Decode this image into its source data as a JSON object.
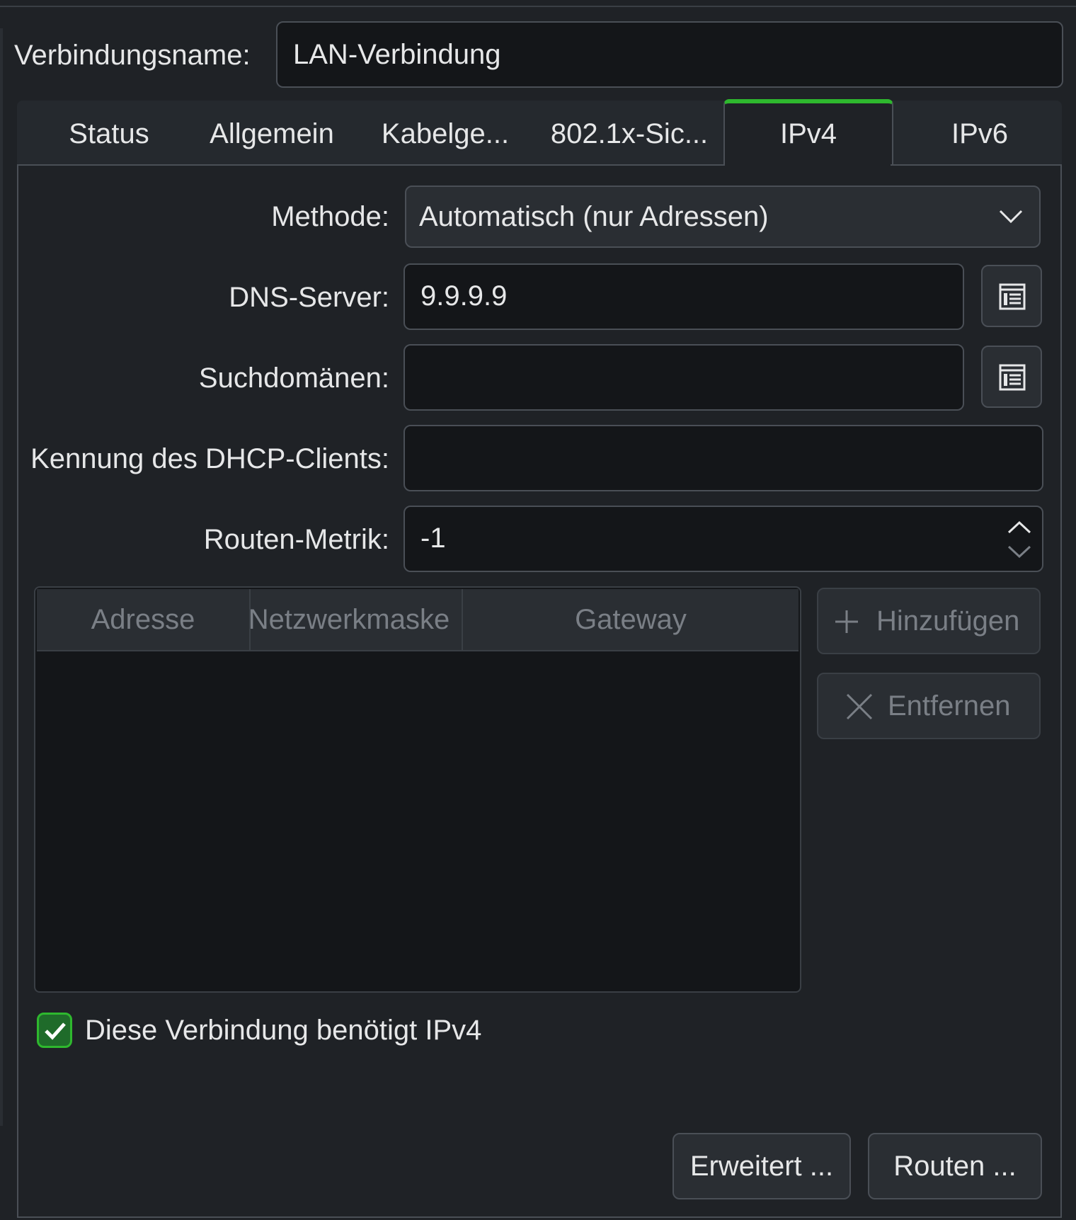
{
  "connection": {
    "name_label": "Verbindungsname:",
    "name_value": "LAN-Verbindung"
  },
  "tabs": [
    {
      "label": "Status"
    },
    {
      "label": "Allgemein"
    },
    {
      "label": "Kabelge..."
    },
    {
      "label": "802.1x-Sic..."
    },
    {
      "label": "IPv4",
      "active": true
    },
    {
      "label": "IPv6"
    }
  ],
  "form": {
    "method_label": "Methode:",
    "method_value": "Automatisch (nur Adressen)",
    "dns_label": "DNS-Server:",
    "dns_value": "9.9.9.9",
    "search_label": "Suchdomänen:",
    "search_value": "",
    "dhcp_label": "Kennung des DHCP-Clients:",
    "dhcp_value": "",
    "metric_label": "Routen-Metrik:",
    "metric_value": "-1"
  },
  "address_table": {
    "columns": [
      "Adresse",
      "Netzwerkmaske",
      "Gateway"
    ],
    "rows": []
  },
  "side_buttons": {
    "add_label": "Hinzufügen",
    "remove_label": "Entfernen"
  },
  "require_ipv4": {
    "label": "Diese Verbindung benötigt IPv4",
    "checked": true
  },
  "footer": {
    "advanced_label": "Erweitert ...",
    "routes_label": "Routen ..."
  },
  "colors": {
    "accent": "#2eb82e",
    "background": "#1f2226",
    "field": "#141619"
  },
  "icons": [
    "chevron-down-icon",
    "list-editor-icon",
    "spin-up-icon",
    "spin-down-icon",
    "plus-icon",
    "close-icon",
    "checkmark-icon"
  ]
}
